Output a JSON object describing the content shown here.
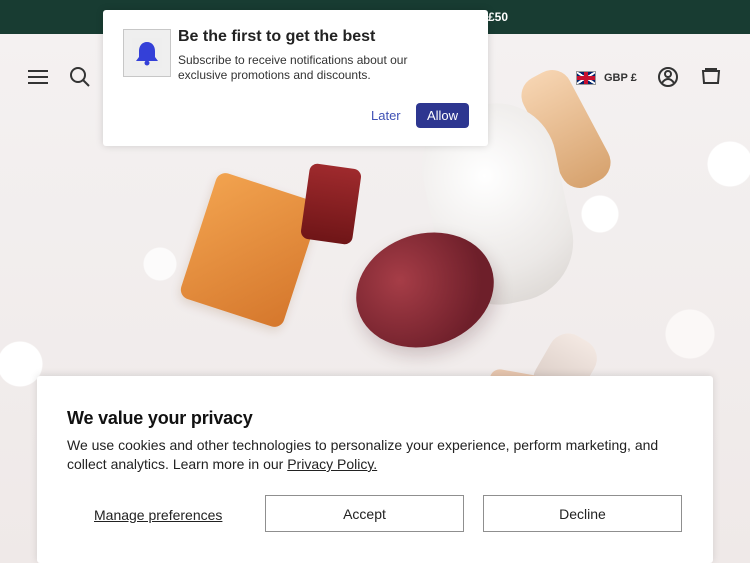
{
  "announcement": {
    "text": "R £50"
  },
  "header": {
    "currency_label": "GBP £",
    "menu_icon": "menu-icon",
    "search_icon": "search-icon",
    "account_icon": "account-icon",
    "cart_icon": "cart-icon"
  },
  "push_prompt": {
    "title": "Be the first to get the best",
    "message": "Subscribe to receive notifications about our exclusive promotions and discounts.",
    "later_label": "Later",
    "allow_label": "Allow",
    "bell_icon": "bell-icon",
    "accent_color": "#2d3690"
  },
  "cookie_banner": {
    "title": "We value your privacy",
    "message_prefix": "We use cookies and other technologies to personalize your experience, perform marketing, and collect analytics. Learn more in our",
    "privacy_link": "Privacy Policy.",
    "manage_label": "Manage preferences",
    "accept_label": "Accept",
    "decline_label": "Decline"
  },
  "colors": {
    "announcement_bg": "#183c32",
    "page_bg": "#f3efee"
  }
}
